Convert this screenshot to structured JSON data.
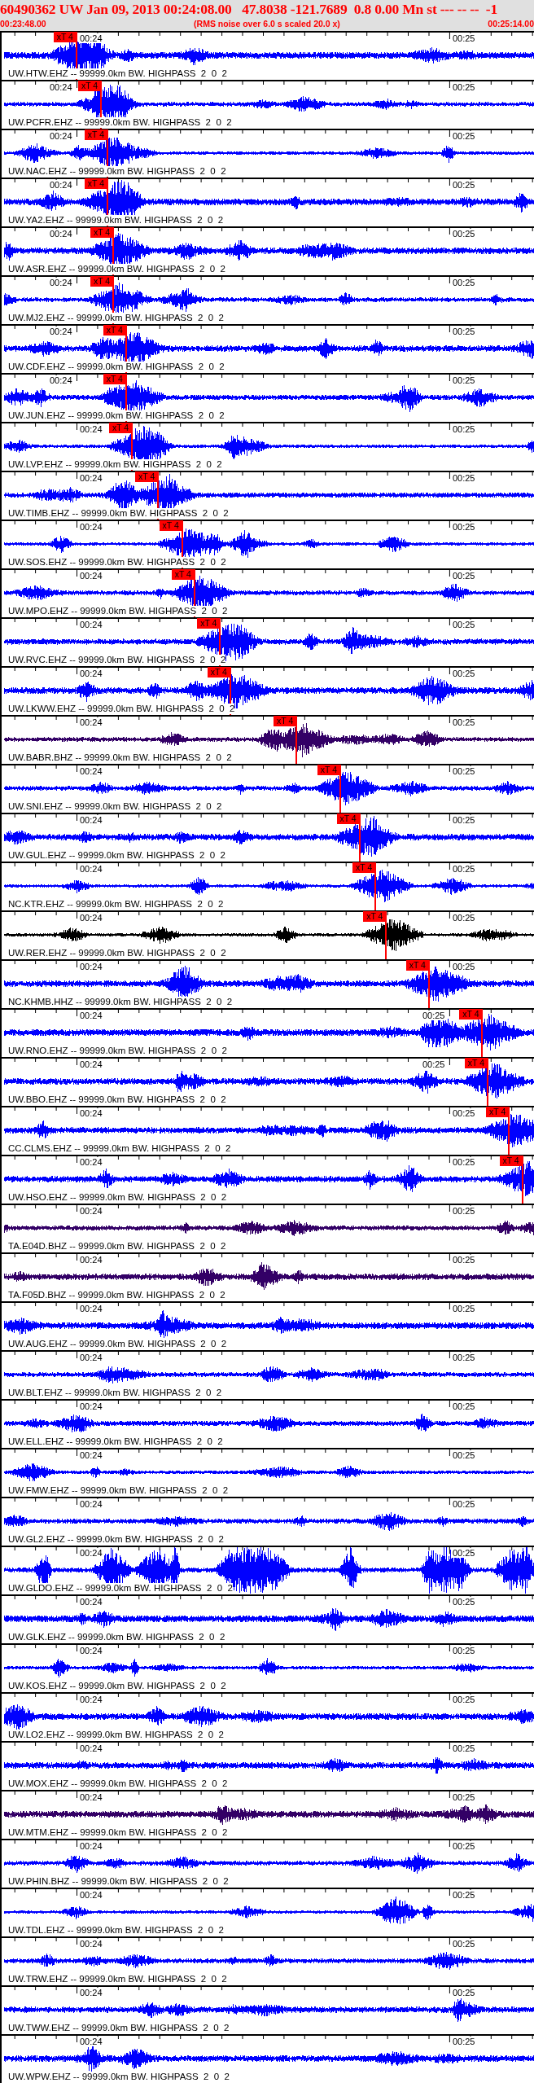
{
  "header": {
    "title": "60490362 UW Jan 09, 2013 00:24:08.00   47.8038 -121.7689  0.8 0.00 Mn st --- -- --  -1",
    "start_time": "00:23:48.00",
    "note": "(RMS noise over 6.0 s scaled 20.0 x)",
    "end_time": "00:25:14.00"
  },
  "traces": [
    {
      "label": "UW.HTW.EHZ -- 99999.0km BW. HIGHPASS  2  0  2",
      "ticks": [
        "00:24",
        "00:25"
      ],
      "color": "#0000ff",
      "pick": {
        "label": "xT 4",
        "level": 0.14
      }
    },
    {
      "label": "UW.PCFR.EHZ -- 99999.0km BW. HIGHPASS  2  0  2",
      "ticks": [
        "00:24",
        "00:25"
      ],
      "color": "#0000ff",
      "pick": {
        "label": "xT 4",
        "level": 0.186
      }
    },
    {
      "label": "UW.NAC.EHZ -- 99999.0km BW. HIGHPASS  2  0  2",
      "ticks": [
        "00:24",
        "00:25"
      ],
      "color": "#0000ff",
      "pick": {
        "label": "xT 4",
        "level": 0.198
      }
    },
    {
      "label": "UW.YA2.EHZ -- 99999.0km BW. HIGHPASS  2  0  2",
      "ticks": [
        "00:24",
        "00:25"
      ],
      "color": "#0000ff",
      "pick": {
        "label": "xT 4",
        "level": 0.198
      }
    },
    {
      "label": "UW.ASR.EHZ -- 99999.0km BW. HIGHPASS  2  0  2",
      "ticks": [
        "00:24",
        "00:25"
      ],
      "color": "#0000ff",
      "pick": {
        "label": "xT 4",
        "level": 0.209
      }
    },
    {
      "label": "UW.MJ2.EHZ -- 99999.0km BW. HIGHPASS  2  0  2",
      "ticks": [
        "00:24",
        "00:25"
      ],
      "color": "#0000ff",
      "pick": {
        "label": "xT 4",
        "level": 0.209
      }
    },
    {
      "label": "UW.CDF.EHZ -- 99999.0km BW. HIGHPASS  2  0  2",
      "ticks": [
        "00:24",
        "00:25"
      ],
      "color": "#0000ff",
      "pick": {
        "label": "xT 4",
        "level": 0.233
      }
    },
    {
      "label": "UW.JUN.EHZ -- 99999.0km BW. HIGHPASS  2  0  2",
      "ticks": [
        "00:24",
        "00:25"
      ],
      "color": "#0000ff",
      "pick": {
        "label": "xT 4",
        "level": 0.233
      }
    },
    {
      "label": "UW.LVP.EHZ -- 99999.0km BW. HIGHPASS  2  0  2",
      "ticks": [
        "00:24",
        "00:25"
      ],
      "color": "#0000ff",
      "pick": {
        "label": "xT 4",
        "level": 0.244
      }
    },
    {
      "label": "UW.TIMB.EHZ -- 99999.0km BW. HIGHPASS  2  0  2",
      "ticks": [
        "00:24",
        "00:25"
      ],
      "color": "#0000ff",
      "pick": {
        "label": "xT 4",
        "level": 0.293
      }
    },
    {
      "label": "UW.SOS.EHZ -- 99999.0km BW. HIGHPASS  2  0  2",
      "ticks": [
        "00:24",
        "00:25"
      ],
      "color": "#0000ff",
      "pick": {
        "label": "xT 4",
        "level": 0.338
      }
    },
    {
      "label": "UW.MPO.EHZ -- 99999.0km BW. HIGHPASS  2  0  2",
      "ticks": [
        "00:24",
        "00:25"
      ],
      "color": "#0000ff",
      "pick": {
        "label": "xT 4",
        "level": 0.361
      }
    },
    {
      "label": "UW.RVC.EHZ -- 99999.0km BW. HIGHPASS  2  0  2",
      "ticks": [
        "00:24",
        "00:25"
      ],
      "color": "#0000ff",
      "pick": {
        "label": "xT 4",
        "level": 0.409
      }
    },
    {
      "label": "UW.LKWW.EHZ -- 99999.0km BW. HIGHPASS  2  0  2",
      "ticks": [
        "00:24",
        "00:25"
      ],
      "color": "#0000ff",
      "pick": {
        "label": "xT 4",
        "level": 0.428
      }
    },
    {
      "label": "UW.BABR.BHZ -- 99999.0km BW. HIGHPASS  2  0  2",
      "ticks": [
        "00:24",
        "00:25"
      ],
      "color": "#330066",
      "pick": {
        "label": "xT 4",
        "level": 0.552
      }
    },
    {
      "label": "UW.SNI.EHZ -- 99999.0km BW. HIGHPASS  2  0  2",
      "ticks": [
        "00:24",
        "00:25"
      ],
      "color": "#0000ff",
      "pick": {
        "label": "xT 4",
        "level": 0.634
      }
    },
    {
      "label": "UW.GUL.EHZ -- 99999.0km BW. HIGHPASS  2  0  2",
      "ticks": [
        "00:24",
        "00:25"
      ],
      "color": "#0000ff",
      "pick": {
        "label": "xT 4",
        "level": 0.67
      }
    },
    {
      "label": "NC.KTR.EHZ -- 99999.0km BW. HIGHPASS  2  0  2",
      "ticks": [
        "00:24",
        "00:25"
      ],
      "color": "#0000ff",
      "pick": {
        "label": "xT 4",
        "level": 0.7
      }
    },
    {
      "label": "UW.RER.EHZ -- 99999.0km BW. HIGHPASS  2  0  2",
      "ticks": [
        "00:24",
        "00:25"
      ],
      "color": "#000000",
      "pick": {
        "label": "xT 4",
        "level": 0.72
      }
    },
    {
      "label": "NC.KHMB.HHZ -- 99999.0km BW. HIGHPASS  2  0  2",
      "ticks": [
        "00:24",
        "00:25"
      ],
      "color": "#0000ff",
      "pick": {
        "label": "xT 4",
        "level": 0.8
      }
    },
    {
      "label": "UW.RNO.EHZ -- 99999.0km BW. HIGHPASS  2  0  2",
      "ticks": [
        "00:24",
        "00:25"
      ],
      "color": "#0000ff",
      "pick": {
        "label": "xT 4",
        "level": 0.9
      }
    },
    {
      "label": "UW.BBO.EHZ -- 99999.0km BW. HIGHPASS  2  0  2",
      "ticks": [
        "00:24",
        "00:25"
      ],
      "color": "#0000ff",
      "pick": {
        "label": "xT 4",
        "level": 0.91
      }
    },
    {
      "label": "CC.CLMS.EHZ -- 99999.0km BW. HIGHPASS  2  0  2",
      "ticks": [
        "00:24",
        "00:25"
      ],
      "color": "#0000ff",
      "pick": {
        "label": "xT 4",
        "level": 0.95
      }
    },
    {
      "label": "UW.HSO.EHZ -- 99999.0km BW. HIGHPASS  2  0  2",
      "ticks": [
        "00:24",
        "00:25"
      ],
      "color": "#0000ff",
      "pick": {
        "label": "xT 4",
        "level": 0.975
      }
    },
    {
      "label": "TA.E04D.BHZ -- 99999.0km BW. HIGHPASS  2  0  2",
      "ticks": [
        "00:24",
        "00:25"
      ],
      "color": "#330066"
    },
    {
      "label": "TA.F05D.BHZ -- 99999.0km BW. HIGHPASS  2  0  2",
      "ticks": [
        "00:24",
        "00:25"
      ],
      "color": "#330066"
    },
    {
      "label": "UW.AUG.EHZ -- 99999.0km BW. HIGHPASS  2  0  2",
      "ticks": [
        "00:24",
        "00:25"
      ],
      "color": "#0000ff"
    },
    {
      "label": "UW.BLT.EHZ -- 99999.0km BW. HIGHPASS  2  0  2",
      "ticks": [
        "00:24",
        "00:25"
      ],
      "color": "#0000ff"
    },
    {
      "label": "UW.ELL.EHZ -- 99999.0km BW. HIGHPASS  2  0  2",
      "ticks": [
        "00:24",
        "00:25"
      ],
      "color": "#0000ff"
    },
    {
      "label": "UW.FMW.EHZ -- 99999.0km BW. HIGHPASS  2  0  2",
      "ticks": [
        "00:24",
        "00:25"
      ],
      "color": "#0000ff"
    },
    {
      "label": "UW.GL2.EHZ -- 99999.0km BW. HIGHPASS  2  0  2",
      "ticks": [
        "00:24",
        "00:25"
      ],
      "color": "#0000ff"
    },
    {
      "label": "UW.GLDO.EHZ -- 99999.0km BW. HIGHPASS  2  0  2",
      "ticks": [
        "00:24",
        "00:25"
      ],
      "color": "#0000ff"
    },
    {
      "label": "UW.GLK.EHZ -- 99999.0km BW. HIGHPASS  2  0  2",
      "ticks": [
        "00:24",
        "00:25"
      ],
      "color": "#0000ff"
    },
    {
      "label": "UW.KOS.EHZ -- 99999.0km BW. HIGHPASS  2  0  2",
      "ticks": [
        "00:24",
        "00:25"
      ],
      "color": "#0000ff"
    },
    {
      "label": "UW.LO2.EHZ -- 99999.0km BW. HIGHPASS  2  0  2",
      "ticks": [
        "00:24",
        "00:25"
      ],
      "color": "#0000ff"
    },
    {
      "label": "UW.MOX.EHZ -- 99999.0km BW. HIGHPASS  2  0  2",
      "ticks": [
        "00:24",
        "00:25"
      ],
      "color": "#0000ff"
    },
    {
      "label": "UW.MTM.EHZ -- 99999.0km BW. HIGHPASS  2  0  2",
      "ticks": [
        "00:24",
        "00:25"
      ],
      "color": "#330066"
    },
    {
      "label": "UW.PHIN.BHZ -- 99999.0km BW. HIGHPASS  2  0  2",
      "ticks": [
        "00:24",
        "00:25"
      ],
      "color": "#0000ff"
    },
    {
      "label": "UW.TDL.EHZ -- 99999.0km BW. HIGHPASS  2  0  2",
      "ticks": [
        "00:24",
        "00:25"
      ],
      "color": "#0000ff"
    },
    {
      "label": "UW.TRW.EHZ -- 99999.0km BW. HIGHPASS  2  0  2",
      "ticks": [
        "00:24",
        "00:25"
      ],
      "color": "#0000ff"
    },
    {
      "label": "UW.TWW.EHZ -- 99999.0km BW. HIGHPASS  2  0  2",
      "ticks": [
        "00:24",
        "00:25"
      ],
      "color": "#0000ff"
    },
    {
      "label": "UW.WPW.EHZ -- 99999.0km BW. HIGHPASS  2  0  2",
      "ticks": [
        "00:24",
        "00:25"
      ],
      "color": "#0000ff"
    }
  ]
}
